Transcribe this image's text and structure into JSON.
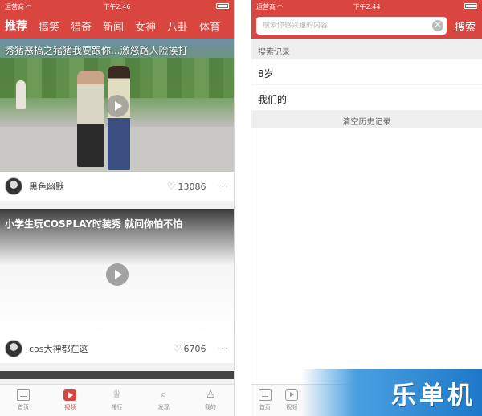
{
  "left_screen": {
    "status_bar": {
      "carrier": "运营商",
      "time": "下午2:46"
    },
    "channel_tabs": [
      {
        "label": "推荐",
        "active": true
      },
      {
        "label": "搞笑",
        "active": false
      },
      {
        "label": "猎奇",
        "active": false
      },
      {
        "label": "新闻",
        "active": false
      },
      {
        "label": "女神",
        "active": false
      },
      {
        "label": "八卦",
        "active": false
      },
      {
        "label": "体育",
        "active": false
      }
    ],
    "feed": [
      {
        "title": "秀猪恶搞之猪猪我要跟你...激怒路人险挨打",
        "author": "黑色幽默",
        "likes": "13086",
        "more": "···"
      },
      {
        "title": "小学生玩COSPLAY时装秀 就问你怕不怕",
        "author": "cos大神都在这",
        "likes": "6706",
        "more": "···"
      }
    ],
    "tab_bar": [
      {
        "label": "首页",
        "icon": "home-icon",
        "active": false
      },
      {
        "label": "视频",
        "icon": "video-icon",
        "active": true
      },
      {
        "label": "排行",
        "icon": "crown-icon",
        "active": false
      },
      {
        "label": "发现",
        "icon": "search-icon",
        "active": false
      },
      {
        "label": "我的",
        "icon": "profile-icon",
        "active": false
      }
    ]
  },
  "right_screen": {
    "status_bar": {
      "carrier": "运营商",
      "time": "下午2:44"
    },
    "search": {
      "placeholder": "搜索你感兴趣的内容",
      "value": "",
      "button_label": "搜索"
    },
    "history": {
      "header": "搜索记录",
      "items": [
        "8岁",
        "我们的"
      ],
      "clear_label": "清空历史记录"
    },
    "tab_bar": [
      {
        "label": "首页",
        "icon": "home-icon"
      },
      {
        "label": "视频",
        "icon": "video-icon"
      }
    ]
  },
  "watermark": {
    "text": "乐单机"
  },
  "colors": {
    "accent": "#d9453f",
    "watermark": "#1e78c8"
  }
}
